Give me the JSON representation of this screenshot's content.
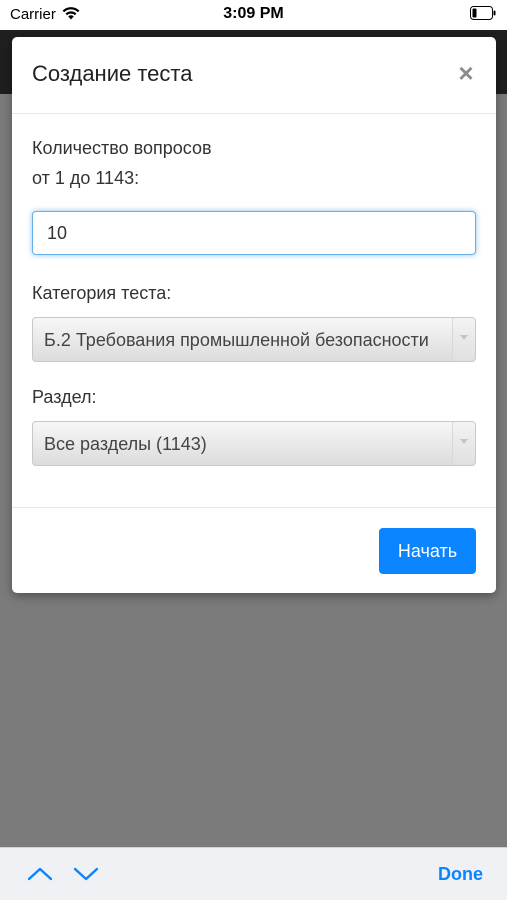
{
  "status_bar": {
    "carrier": "Carrier",
    "time": "3:09 PM"
  },
  "modal": {
    "title": "Создание теста",
    "close_label": "×",
    "question_count_label_line1": "Количество вопросов",
    "question_count_label_line2": "от 1 до 1143:",
    "question_count_value": "10",
    "category_label": "Категория теста:",
    "category_selected": "Б.2 Требования промышленной безопасности",
    "section_label": "Раздел:",
    "section_selected": "Все разделы (1143)",
    "start_button": "Начать"
  },
  "keyboard_toolbar": {
    "done_label": "Done"
  },
  "colors": {
    "accent": "#0a84ff",
    "overlay": "#7b7b7b",
    "focus_border": "#66afe9"
  }
}
